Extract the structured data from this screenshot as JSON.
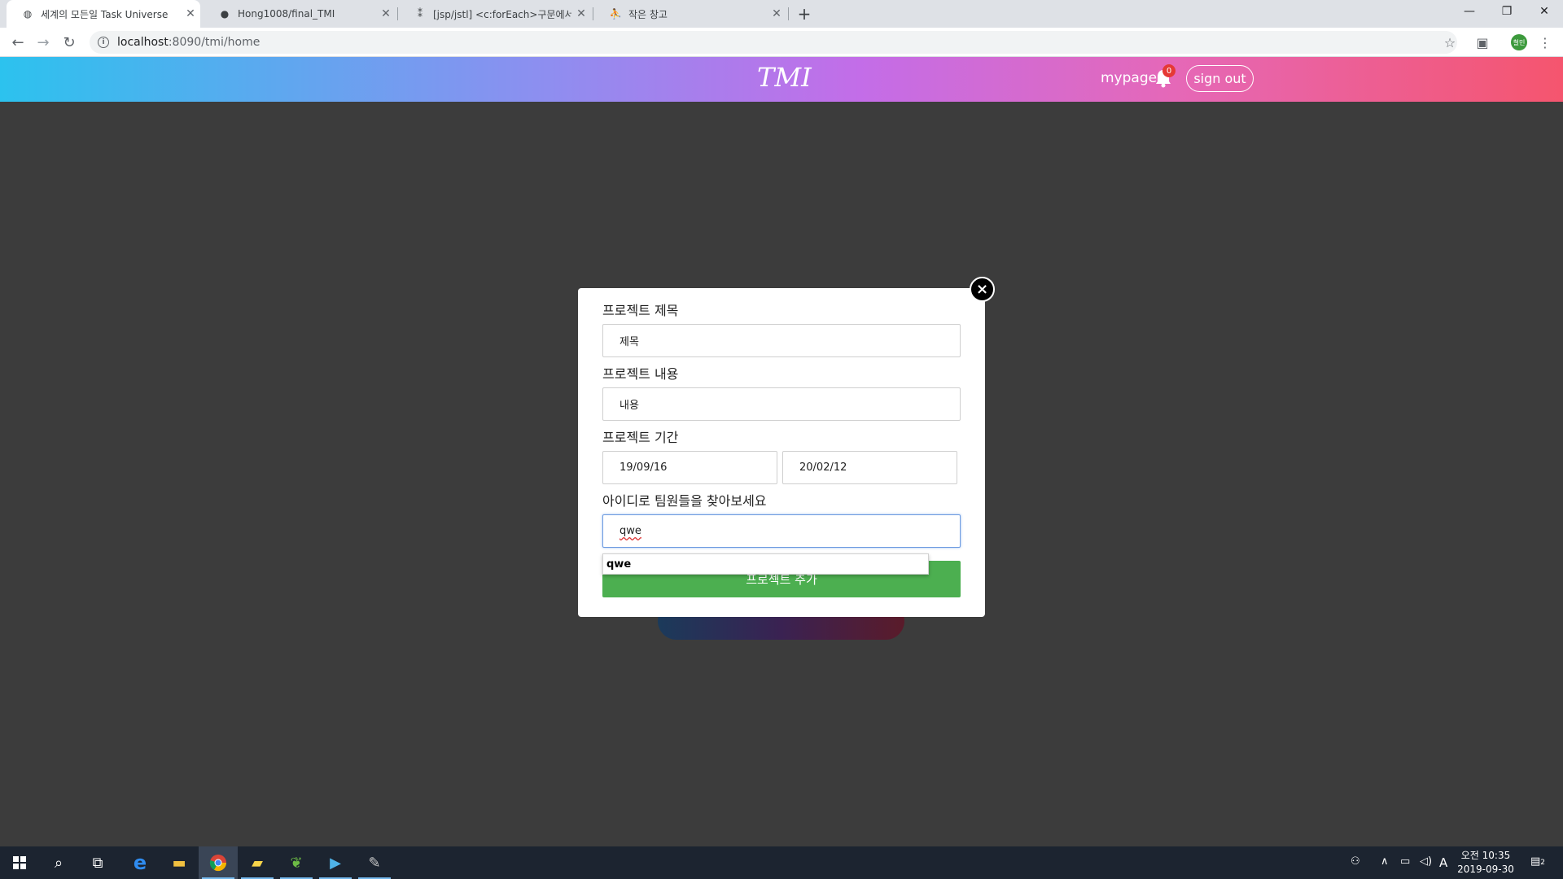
{
  "browser": {
    "tabs": [
      {
        "title": "세계의 모든일 Task Universe",
        "icon": "globe-icon"
      },
      {
        "title": "Hong1008/final_TMI",
        "icon": "github-icon"
      },
      {
        "title": "[jsp/jstl] <c:forEach>구문에서 b",
        "icon": "blog-icon"
      },
      {
        "title": "작은 창고",
        "icon": "blog-person-icon"
      }
    ],
    "address": {
      "host": "localhost",
      "path": ":8090/tmi/home"
    },
    "profile_label": "철민"
  },
  "header": {
    "logo": "TMI",
    "mypage": "mypage",
    "notification_count": "0",
    "signout": "sign out"
  },
  "modal": {
    "title_label": "프로젝트 제목",
    "title_placeholder": "제목",
    "content_label": "프로젝트 내용",
    "content_placeholder": "내용",
    "period_label": "프로젝트 기간",
    "start_date": "19/09/16",
    "end_date": "20/02/12",
    "member_label": "아이디로 팀원들을 찾아보세요",
    "member_value": "qwe",
    "suggestion": "qwe",
    "submit": "프로젝트 추가",
    "close": "×"
  },
  "taskbar": {
    "clock_time": "오전 10:35",
    "clock_date": "2019-09-30",
    "notification_count": "2",
    "ime": "A"
  },
  "colors": {
    "header_gradient": [
      "#2cc2ee",
      "#c36de8",
      "#f5556e"
    ],
    "submit": "#4caf50",
    "backdrop": "#3c3c3c"
  }
}
